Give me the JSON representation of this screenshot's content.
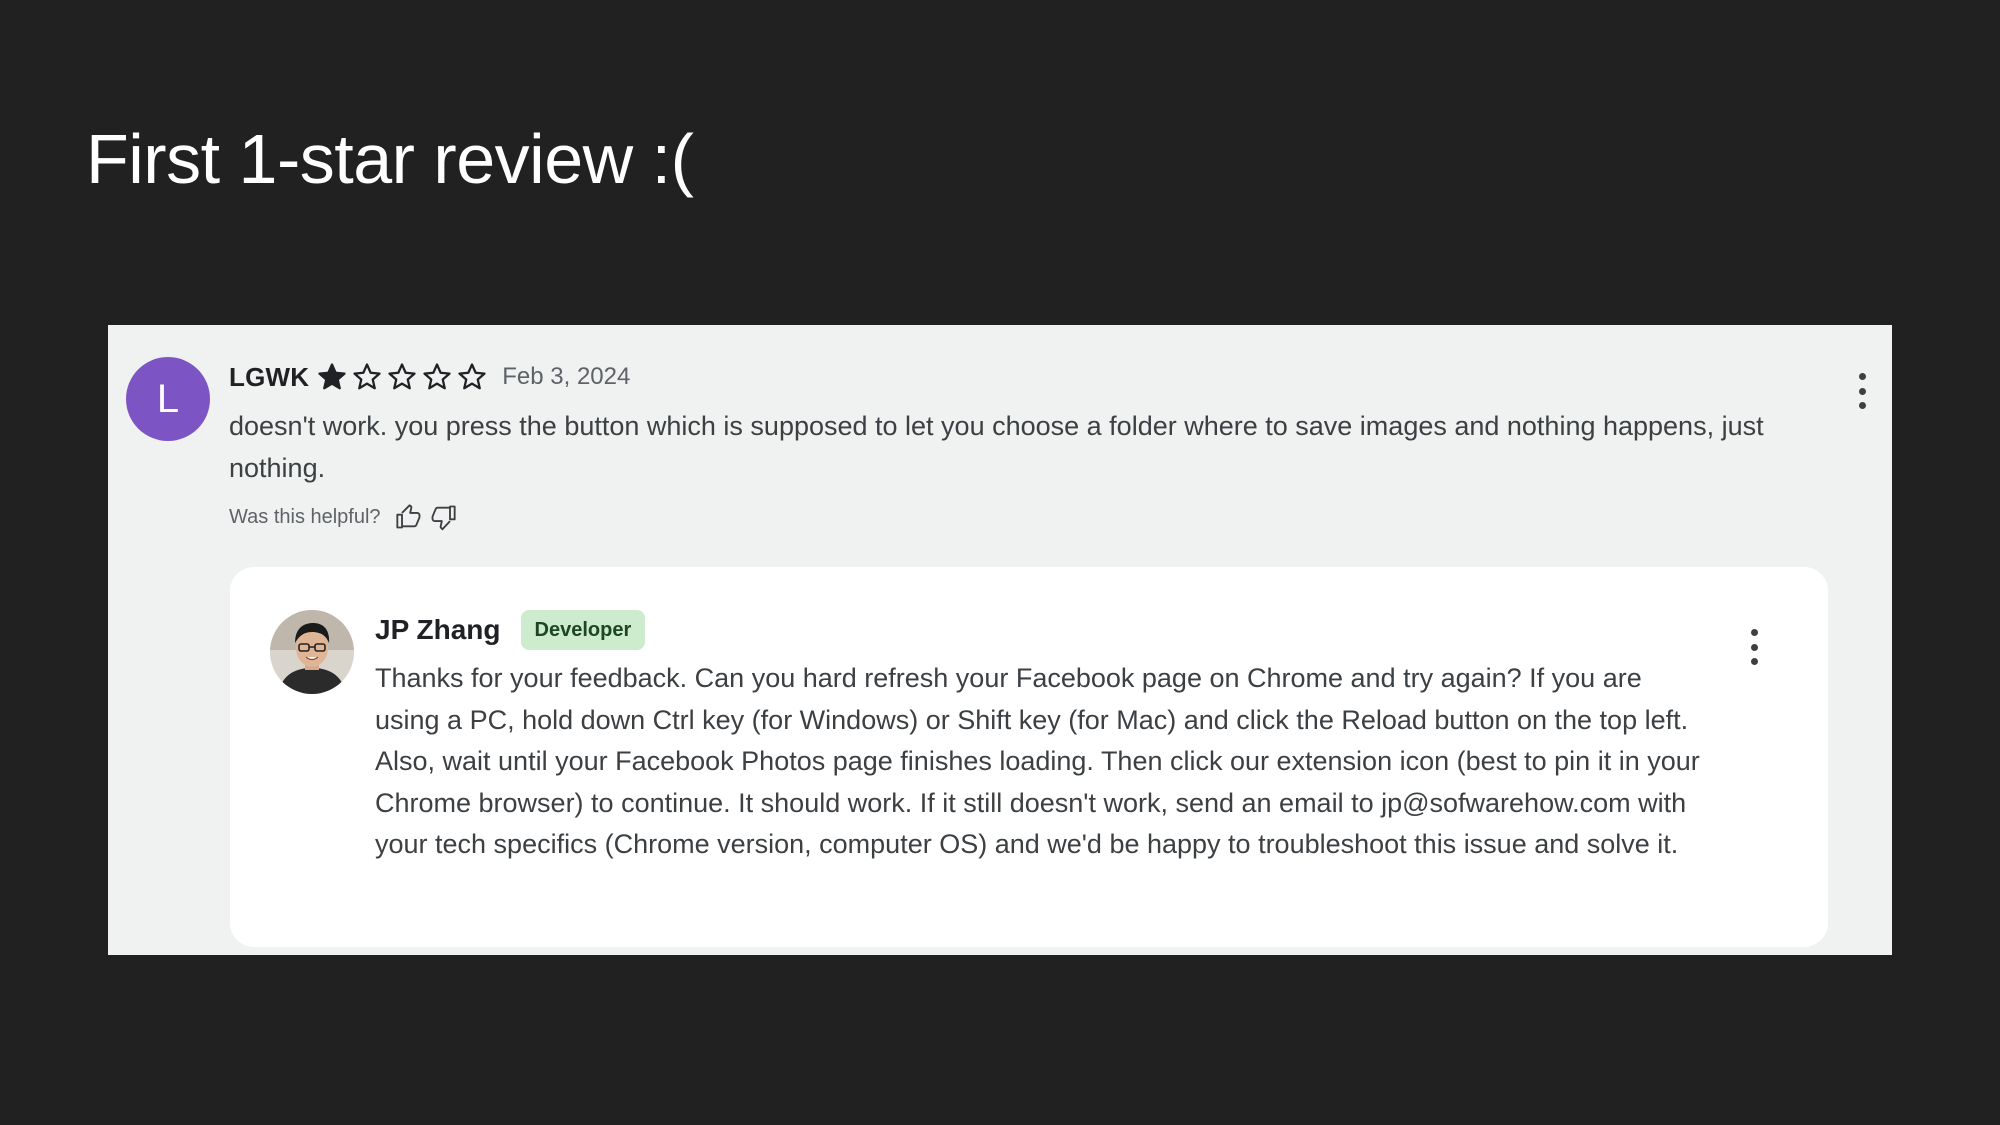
{
  "slide": {
    "title": "First 1-star review :("
  },
  "review": {
    "avatar_letter": "L",
    "avatar_color": "#7c54c4",
    "reviewer_name": "LGWK",
    "rating": 1,
    "rating_max": 5,
    "date": "Feb 3, 2024",
    "text": "doesn't work. you press the button which is supposed to let you choose a folder where to save images and nothing happens, just nothing.",
    "helpful_label": "Was this helpful?",
    "helpful_yes_icon": "thumbs-up-icon",
    "helpful_no_icon": "thumbs-down-icon",
    "more_icon": "more-vert-icon"
  },
  "reply": {
    "author_name": "JP Zhang",
    "badge": "Developer",
    "badge_color": "#cdeccd",
    "text": "Thanks for your feedback. Can you hard refresh your Facebook page on Chrome and try again? If you are using a PC, hold down Ctrl key (for Windows) or Shift key (for Mac) and click the Reload button on the top left. Also, wait until your Facebook Photos page finishes loading. Then click our extension icon (best to pin it in your Chrome browser) to continue. It should work. If it still doesn't work, send an email to jp@sofwarehow.com with your tech specifics (Chrome version, computer OS) and we'd be happy to troubleshoot this issue and solve it.",
    "more_icon": "more-vert-icon"
  },
  "colors": {
    "background": "#212121",
    "panel": "#f0f1f1",
    "star": "#202124"
  }
}
